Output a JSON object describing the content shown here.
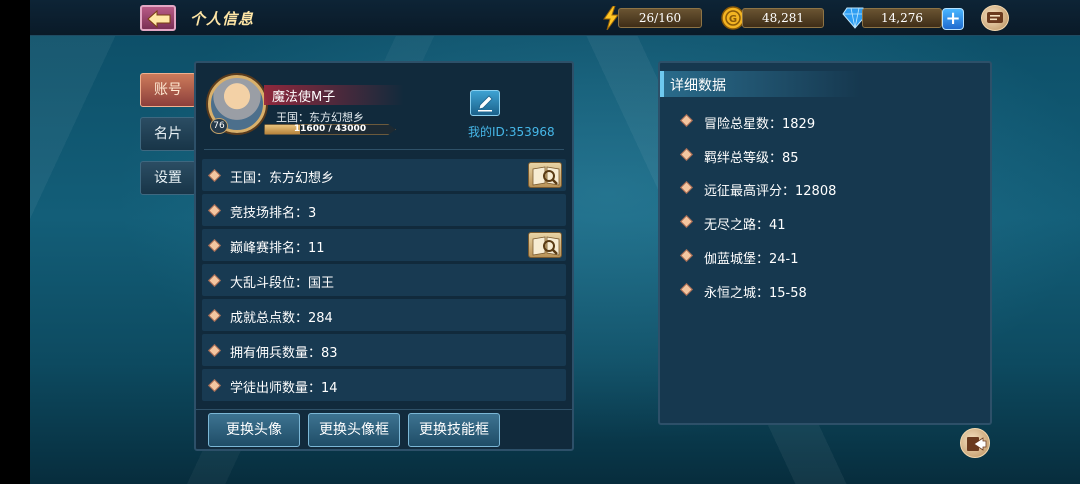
{
  "header": {
    "title": "个人信息",
    "energy": "26/160",
    "gold": "48,281",
    "gems": "14,276",
    "plus_label": "+"
  },
  "tabs": [
    "账号",
    "名片",
    "设置"
  ],
  "profile": {
    "name": "魔法使M子",
    "kingdom": "王国：东方幻想乡",
    "exp": "11600 / 43000",
    "exp_fraction": 0.27,
    "level": "76",
    "player_id": "我的ID:353968"
  },
  "info_rows": [
    "王国：东方幻想乡",
    "竞技场排名：3",
    "巅峰赛排名：11",
    "大乱斗段位：国王",
    "成就总点数：284",
    "拥有佣兵数量：83",
    "学徒出师数量：14"
  ],
  "actions": [
    "更换头像",
    "更换头像框",
    "更换技能框"
  ],
  "detail": {
    "title": "详细数据",
    "rows": [
      "冒险总星数：1829",
      "羁绊总等级：85",
      "远征最高评分：12808",
      "无尽之路：41",
      "伽蓝城堡：24-1",
      "永恒之城：15-58"
    ]
  },
  "colors": {
    "accent": "#46b7e8",
    "title": "#ffe6a6",
    "tab_active": "#cd7b5a"
  }
}
